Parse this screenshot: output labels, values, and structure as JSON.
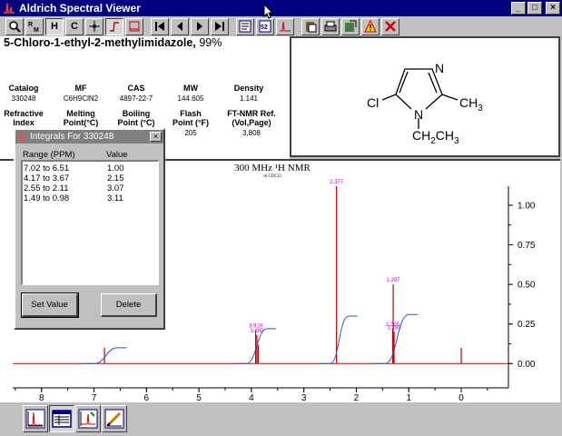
{
  "window": {
    "title": "Aldrich Spectral Viewer",
    "minimize": "_",
    "maximize": "□",
    "close": "×"
  },
  "toolbar": {
    "buttons": [
      {
        "name": "zoom-icon",
        "label": ""
      },
      {
        "name": "rm-label-icon",
        "label": "R M"
      },
      {
        "name": "h-nmr-button",
        "label": "H"
      },
      {
        "name": "c-nmr-button",
        "label": "C"
      },
      {
        "name": "crosshair-icon",
        "label": ""
      },
      {
        "name": "integral-icon",
        "label": ""
      },
      {
        "name": "baseline-icon",
        "label": ""
      },
      {
        "name": "first-icon",
        "label": ""
      },
      {
        "name": "prev-icon",
        "label": ""
      },
      {
        "name": "next-icon",
        "label": ""
      },
      {
        "name": "last-icon",
        "label": ""
      },
      {
        "name": "text-icon",
        "label": ""
      },
      {
        "name": "eval-icon",
        "label": ""
      },
      {
        "name": "peak-icon",
        "label": ""
      },
      {
        "name": "paste-icon",
        "label": ""
      },
      {
        "name": "print-icon",
        "label": ""
      },
      {
        "name": "export-icon",
        "label": ""
      },
      {
        "name": "warning-icon",
        "label": ""
      },
      {
        "name": "delete-icon",
        "label": ""
      }
    ]
  },
  "compound": {
    "name": "5-Chloro-1-ethyl-2-methylimidazole,",
    "purity": " 99%",
    "properties_row1": [
      {
        "head": "Catalog",
        "value": "330248"
      },
      {
        "head": "MF",
        "value": "C6H9ClN2"
      },
      {
        "head": "CAS",
        "value": "4897-22-7"
      },
      {
        "head": "MW",
        "value": "144.605"
      },
      {
        "head": "Density",
        "value": "1.141"
      }
    ],
    "properties_row2": [
      {
        "head1": "Refractive",
        "head2": "Index",
        "value": ""
      },
      {
        "head1": "Melting",
        "head2": "Point(°C)",
        "value": ""
      },
      {
        "head1": "Boiling",
        "head2": "Point (°C)",
        "value": ""
      },
      {
        "head1": "Flash",
        "head2": "Point (°F)",
        "value": "205"
      },
      {
        "head1": "FT-NMR Ref.",
        "head2": "(Vol,Page)",
        "value": "3,808"
      }
    ]
  },
  "structure": {
    "atoms": {
      "n3": "N",
      "n1": "N",
      "cl": "Cl",
      "ch3": "CH",
      "ch3_sub": "3",
      "ethyl": "CH",
      "ethyl_sub2": "2",
      "ethyl_ch3": "CH",
      "ethyl_sub3": "3"
    }
  },
  "spectrum": {
    "title": "300 MHz ¹H NMR",
    "solvent": "in CDCl3",
    "peak_labels": [
      "2.377",
      "1.297",
      "3.919",
      "3.895",
      "1.305",
      "1.280"
    ],
    "x_ticks": [
      "8",
      "7",
      "6",
      "5",
      "4",
      "3",
      "2",
      "1",
      "0"
    ],
    "y_ticks": [
      "1.00",
      "0.75",
      "0.50",
      "0.25",
      "0.00"
    ]
  },
  "chart_data": {
    "type": "line",
    "title": "300 MHz ¹H NMR",
    "subtitle": "in CDCl3",
    "xlabel": "",
    "ylabel": "",
    "xlim": [
      8.55,
      -0.9
    ],
    "ylim": [
      -0.05,
      1.12
    ],
    "peaks": [
      {
        "ppm": 6.8,
        "height": 0.1
      },
      {
        "ppm": 3.919,
        "height": 0.21
      },
      {
        "ppm": 3.895,
        "height": 0.18
      },
      {
        "ppm": 3.87,
        "height": 0.12
      },
      {
        "ppm": 2.377,
        "height": 1.12
      },
      {
        "ppm": 1.305,
        "height": 0.22
      },
      {
        "ppm": 1.297,
        "height": 0.5
      },
      {
        "ppm": 1.28,
        "height": 0.2
      },
      {
        "ppm": 0.0,
        "height": 0.1
      }
    ],
    "integral_steps": [
      {
        "from": 7.0,
        "to": 6.55,
        "start": 0.0,
        "end": 0.1
      },
      {
        "from": 4.1,
        "to": 3.7,
        "start": 0.0,
        "end": 0.22
      },
      {
        "from": 2.5,
        "to": 2.15,
        "start": 0.0,
        "end": 0.3
      },
      {
        "from": 1.45,
        "to": 1.0,
        "start": 0.0,
        "end": 0.31
      }
    ],
    "colors": {
      "spectrum": "#cc0000",
      "integral": "#3050d0",
      "peak_label": "#cc00cc"
    }
  },
  "integrals": {
    "title": "Integrals For 330248",
    "col_range": "Range (PPM)",
    "col_value": "Value",
    "rows": [
      {
        "range": "7.02 to 6.51",
        "value": "1.00"
      },
      {
        "range": "4.17 to 3.67",
        "value": "2.15"
      },
      {
        "range": "2.55 to 2.11",
        "value": "3.07"
      },
      {
        "range": "1.49 to 0.98",
        "value": "3.11"
      }
    ],
    "set_value": "Set Value",
    "delete": "Delete",
    "close": "×"
  }
}
